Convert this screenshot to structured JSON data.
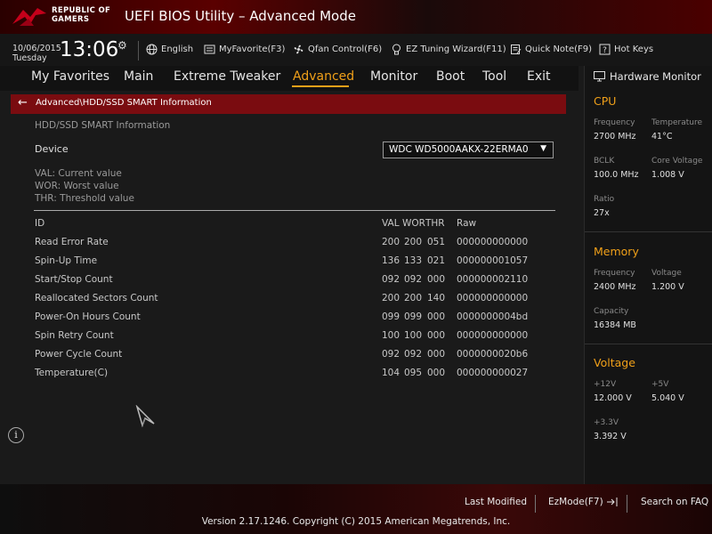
{
  "header": {
    "brand_line1": "REPUBLIC OF",
    "brand_line2": "GAMERS",
    "title": "UEFI BIOS Utility – Advanced Mode"
  },
  "infobar": {
    "date": "10/06/2015",
    "day": "Tuesday",
    "time": "13:06",
    "tools": [
      {
        "label": "English",
        "icon": "globe-icon"
      },
      {
        "label": "MyFavorite(F3)",
        "icon": "favorite-icon"
      },
      {
        "label": "Qfan Control(F6)",
        "icon": "fan-icon"
      },
      {
        "label": "EZ Tuning Wizard(F11)",
        "icon": "bulb-icon"
      },
      {
        "label": "Quick Note(F9)",
        "icon": "note-icon"
      },
      {
        "label": "Hot Keys",
        "icon": "help-icon"
      }
    ]
  },
  "nav": {
    "items": [
      "My Favorites",
      "Main",
      "Extreme Tweaker",
      "Advanced",
      "Monitor",
      "Boot",
      "Tool",
      "Exit"
    ],
    "active": "Advanced"
  },
  "breadcrumb": "Advanced\\HDD/SSD SMART Information",
  "main": {
    "section_title": "HDD/SSD SMART Information",
    "device_label": "Device",
    "device_value": "WDC WD5000AAKX-22ERMA0",
    "legend": [
      "VAL:  Current value",
      "WOR: Worst value",
      "THR:  Threshold value"
    ],
    "columns": {
      "id": "ID",
      "val": "VAL",
      "wor": "WOR",
      "thr": "THR",
      "raw": "Raw"
    },
    "rows": [
      {
        "id": "Read Error Rate",
        "val": "200",
        "wor": "200",
        "thr": "051",
        "raw": "000000000000"
      },
      {
        "id": "Spin-Up Time",
        "val": "136",
        "wor": "133",
        "thr": "021",
        "raw": "000000001057"
      },
      {
        "id": "Start/Stop Count",
        "val": "092",
        "wor": "092",
        "thr": "000",
        "raw": "000000002110"
      },
      {
        "id": "Reallocated Sectors Count",
        "val": "200",
        "wor": "200",
        "thr": "140",
        "raw": "000000000000"
      },
      {
        "id": "Power-On Hours Count",
        "val": "099",
        "wor": "099",
        "thr": "000",
        "raw": "0000000004bd"
      },
      {
        "id": "Spin Retry Count",
        "val": "100",
        "wor": "100",
        "thr": "000",
        "raw": "000000000000"
      },
      {
        "id": "Power Cycle Count",
        "val": "092",
        "wor": "092",
        "thr": "000",
        "raw": "0000000020b6"
      },
      {
        "id": "Temperature(C)",
        "val": "104",
        "wor": "095",
        "thr": "000",
        "raw": "000000000027"
      }
    ]
  },
  "hw_monitor": {
    "title": "Hardware Monitor",
    "cpu": {
      "heading": "CPU",
      "frequency_label": "Frequency",
      "frequency": "2700 MHz",
      "temperature_label": "Temperature",
      "temperature": "41°C",
      "bclk_label": "BCLK",
      "bclk": "100.0 MHz",
      "core_voltage_label": "Core Voltage",
      "core_voltage": "1.008 V",
      "ratio_label": "Ratio",
      "ratio": "27x"
    },
    "memory": {
      "heading": "Memory",
      "frequency_label": "Frequency",
      "frequency": "2400 MHz",
      "voltage_label": "Voltage",
      "voltage": "1.200 V",
      "capacity_label": "Capacity",
      "capacity": "16384 MB"
    },
    "voltage": {
      "heading": "Voltage",
      "v12_label": "+12V",
      "v12": "12.000 V",
      "v5_label": "+5V",
      "v5": "5.040 V",
      "v33_label": "+3.3V",
      "v33": "3.392 V"
    }
  },
  "footer": {
    "last_modified": "Last Modified",
    "ezmode": "EzMode(F7)",
    "search": "Search on FAQ",
    "version": "Version 2.17.1246. Copyright (C) 2015 American Megatrends, Inc."
  },
  "colors": {
    "accent": "#f0a019",
    "breadcrumb_bg": "#7a0c10",
    "brand_red": "#5a0000"
  }
}
